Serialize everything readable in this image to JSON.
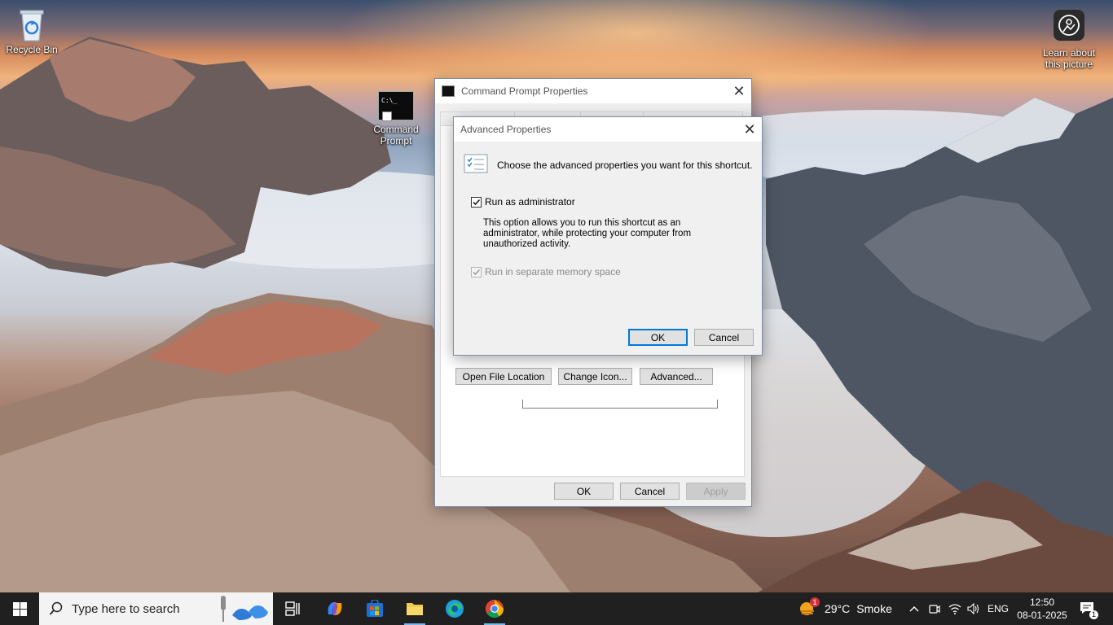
{
  "desktop": {
    "icons": {
      "recycle_bin": "Recycle Bin",
      "command_prompt": "Command Prompt",
      "learn_about": "Learn about this picture"
    }
  },
  "props_window": {
    "title": "Command Prompt Properties",
    "buttons": {
      "open_file_location": "Open File Location",
      "change_icon": "Change Icon...",
      "advanced": "Advanced...",
      "ok": "OK",
      "cancel": "Cancel",
      "apply": "Apply"
    }
  },
  "adv_dialog": {
    "title": "Advanced Properties",
    "heading": "Choose the advanced properties you want for this shortcut.",
    "run_as_admin": {
      "label": "Run as administrator",
      "checked": true,
      "description": "This option allows you to run this shortcut as an administrator, while protecting your computer from unauthorized activity."
    },
    "separate_memory": {
      "label": "Run in separate memory space",
      "checked": true,
      "enabled": false
    },
    "ok": "OK",
    "cancel": "Cancel"
  },
  "taskbar": {
    "search_placeholder": "Type here to search",
    "weather": {
      "temp": "29°C",
      "condition": "Smoke",
      "badge": "1"
    },
    "language": "ENG",
    "time": "12:50",
    "date": "08-01-2025",
    "notification_count": "1"
  },
  "colors": {
    "taskbar": "#202020",
    "accent": "#0078d7"
  }
}
